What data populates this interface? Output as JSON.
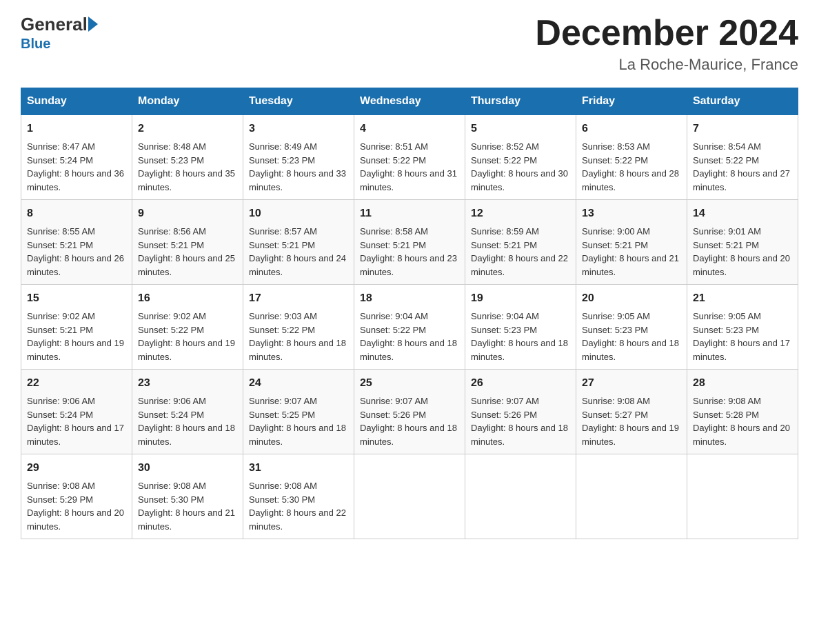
{
  "header": {
    "logo_general": "General",
    "logo_blue": "Blue",
    "month_title": "December 2024",
    "location": "La Roche-Maurice, France"
  },
  "days_of_week": [
    "Sunday",
    "Monday",
    "Tuesday",
    "Wednesday",
    "Thursday",
    "Friday",
    "Saturday"
  ],
  "weeks": [
    [
      {
        "day": "1",
        "sunrise": "8:47 AM",
        "sunset": "5:24 PM",
        "daylight": "8 hours and 36 minutes."
      },
      {
        "day": "2",
        "sunrise": "8:48 AM",
        "sunset": "5:23 PM",
        "daylight": "8 hours and 35 minutes."
      },
      {
        "day": "3",
        "sunrise": "8:49 AM",
        "sunset": "5:23 PM",
        "daylight": "8 hours and 33 minutes."
      },
      {
        "day": "4",
        "sunrise": "8:51 AM",
        "sunset": "5:22 PM",
        "daylight": "8 hours and 31 minutes."
      },
      {
        "day": "5",
        "sunrise": "8:52 AM",
        "sunset": "5:22 PM",
        "daylight": "8 hours and 30 minutes."
      },
      {
        "day": "6",
        "sunrise": "8:53 AM",
        "sunset": "5:22 PM",
        "daylight": "8 hours and 28 minutes."
      },
      {
        "day": "7",
        "sunrise": "8:54 AM",
        "sunset": "5:22 PM",
        "daylight": "8 hours and 27 minutes."
      }
    ],
    [
      {
        "day": "8",
        "sunrise": "8:55 AM",
        "sunset": "5:21 PM",
        "daylight": "8 hours and 26 minutes."
      },
      {
        "day": "9",
        "sunrise": "8:56 AM",
        "sunset": "5:21 PM",
        "daylight": "8 hours and 25 minutes."
      },
      {
        "day": "10",
        "sunrise": "8:57 AM",
        "sunset": "5:21 PM",
        "daylight": "8 hours and 24 minutes."
      },
      {
        "day": "11",
        "sunrise": "8:58 AM",
        "sunset": "5:21 PM",
        "daylight": "8 hours and 23 minutes."
      },
      {
        "day": "12",
        "sunrise": "8:59 AM",
        "sunset": "5:21 PM",
        "daylight": "8 hours and 22 minutes."
      },
      {
        "day": "13",
        "sunrise": "9:00 AM",
        "sunset": "5:21 PM",
        "daylight": "8 hours and 21 minutes."
      },
      {
        "day": "14",
        "sunrise": "9:01 AM",
        "sunset": "5:21 PM",
        "daylight": "8 hours and 20 minutes."
      }
    ],
    [
      {
        "day": "15",
        "sunrise": "9:02 AM",
        "sunset": "5:21 PM",
        "daylight": "8 hours and 19 minutes."
      },
      {
        "day": "16",
        "sunrise": "9:02 AM",
        "sunset": "5:22 PM",
        "daylight": "8 hours and 19 minutes."
      },
      {
        "day": "17",
        "sunrise": "9:03 AM",
        "sunset": "5:22 PM",
        "daylight": "8 hours and 18 minutes."
      },
      {
        "day": "18",
        "sunrise": "9:04 AM",
        "sunset": "5:22 PM",
        "daylight": "8 hours and 18 minutes."
      },
      {
        "day": "19",
        "sunrise": "9:04 AM",
        "sunset": "5:23 PM",
        "daylight": "8 hours and 18 minutes."
      },
      {
        "day": "20",
        "sunrise": "9:05 AM",
        "sunset": "5:23 PM",
        "daylight": "8 hours and 18 minutes."
      },
      {
        "day": "21",
        "sunrise": "9:05 AM",
        "sunset": "5:23 PM",
        "daylight": "8 hours and 17 minutes."
      }
    ],
    [
      {
        "day": "22",
        "sunrise": "9:06 AM",
        "sunset": "5:24 PM",
        "daylight": "8 hours and 17 minutes."
      },
      {
        "day": "23",
        "sunrise": "9:06 AM",
        "sunset": "5:24 PM",
        "daylight": "8 hours and 18 minutes."
      },
      {
        "day": "24",
        "sunrise": "9:07 AM",
        "sunset": "5:25 PM",
        "daylight": "8 hours and 18 minutes."
      },
      {
        "day": "25",
        "sunrise": "9:07 AM",
        "sunset": "5:26 PM",
        "daylight": "8 hours and 18 minutes."
      },
      {
        "day": "26",
        "sunrise": "9:07 AM",
        "sunset": "5:26 PM",
        "daylight": "8 hours and 18 minutes."
      },
      {
        "day": "27",
        "sunrise": "9:08 AM",
        "sunset": "5:27 PM",
        "daylight": "8 hours and 19 minutes."
      },
      {
        "day": "28",
        "sunrise": "9:08 AM",
        "sunset": "5:28 PM",
        "daylight": "8 hours and 20 minutes."
      }
    ],
    [
      {
        "day": "29",
        "sunrise": "9:08 AM",
        "sunset": "5:29 PM",
        "daylight": "8 hours and 20 minutes."
      },
      {
        "day": "30",
        "sunrise": "9:08 AM",
        "sunset": "5:30 PM",
        "daylight": "8 hours and 21 minutes."
      },
      {
        "day": "31",
        "sunrise": "9:08 AM",
        "sunset": "5:30 PM",
        "daylight": "8 hours and 22 minutes."
      },
      null,
      null,
      null,
      null
    ]
  ],
  "labels": {
    "sunrise": "Sunrise:",
    "sunset": "Sunset:",
    "daylight": "Daylight:"
  }
}
